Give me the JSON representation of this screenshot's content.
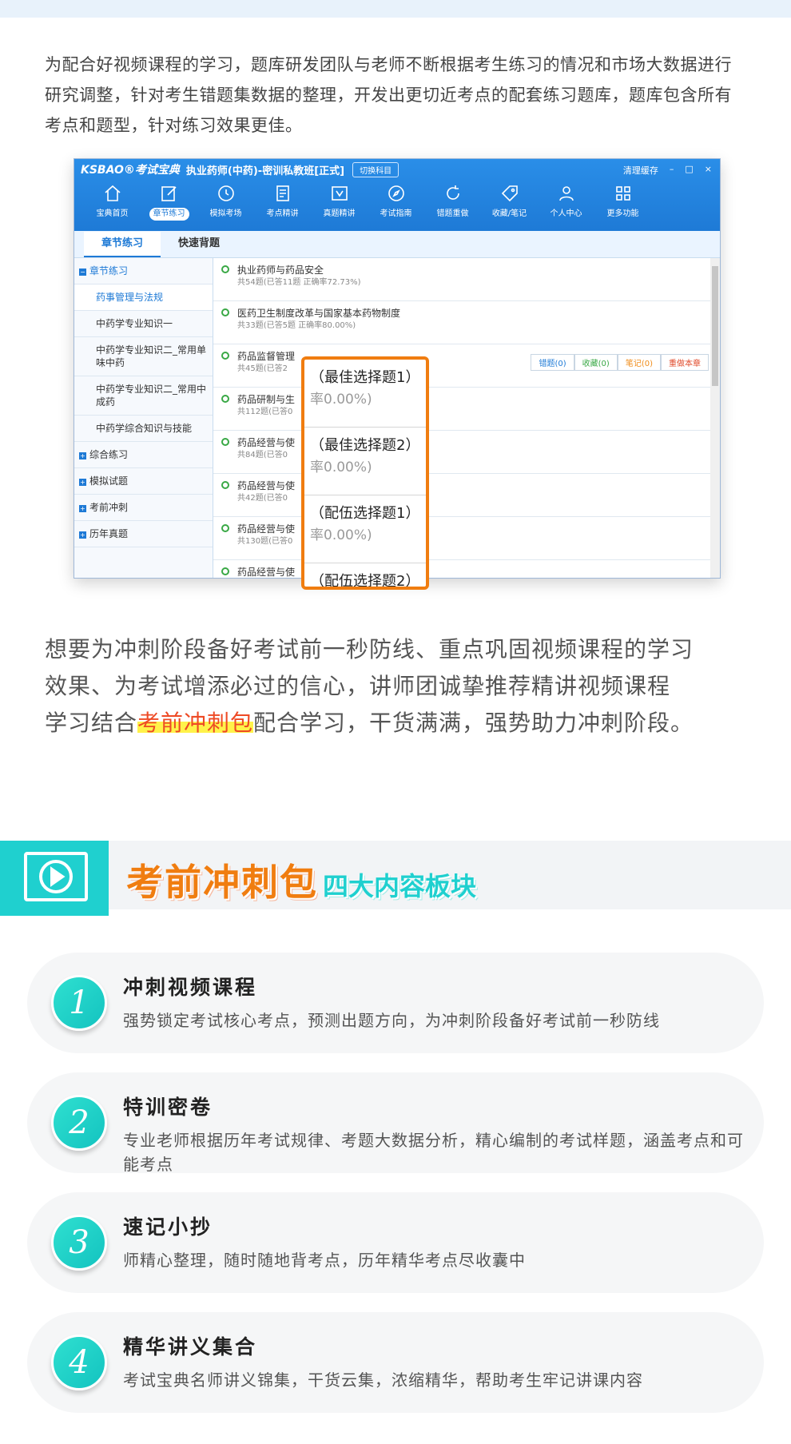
{
  "intro_text": "为配合好视频课程的学习，题库研发团队与老师不断根据考生练习的情况和市场大数据进行研究调整，针对考生错题集数据的整理，开发出更切近考点的配套练习题库，题库包含所有考点和题型，针对练习效果更佳。",
  "app": {
    "logo": "KSBAO®考试宝典",
    "title": "执业药师(中药)-密训私教班[正式]",
    "switch_label": "切换科目",
    "clear_cache": "清理缓存",
    "toolbar": [
      {
        "label": "宝典首页",
        "icon": "home-icon"
      },
      {
        "label": "章节练习",
        "icon": "edit-icon",
        "active": true
      },
      {
        "label": "模拟考场",
        "icon": "clock-icon"
      },
      {
        "label": "考点精讲",
        "icon": "document-icon"
      },
      {
        "label": "真题精讲",
        "icon": "book-icon"
      },
      {
        "label": "考试指南",
        "icon": "compass-icon"
      },
      {
        "label": "错题重做",
        "icon": "refresh-icon"
      },
      {
        "label": "收藏/笔记",
        "icon": "tag-icon"
      },
      {
        "label": "个人中心",
        "icon": "user-icon"
      },
      {
        "label": "更多功能",
        "icon": "grid-icon"
      }
    ],
    "tabs": [
      "章节练习",
      "快速背题"
    ],
    "sidebar": {
      "root": "章节练习",
      "subitems": [
        "药事管理与法规",
        "中药学专业知识一",
        "中药学专业知识二_常用单味中药",
        "中药学专业知识二_常用中成药",
        "中药学综合知识与技能"
      ],
      "groups": [
        "综合练习",
        "模拟试题",
        "考前冲刺",
        "历年真题"
      ]
    },
    "rows": [
      {
        "title": "执业药师与药品安全",
        "sub": "共54题(已答11题   正确率72.73%)"
      },
      {
        "title": "医药卫生制度改革与国家基本药物制度",
        "sub": "共33题(已答5题   正确率80.00%)"
      },
      {
        "title": "药品监督管理",
        "sub": "共45题(已答2"
      },
      {
        "title": "药品研制与生",
        "sub": "共112题(已答0"
      },
      {
        "title": "药品经营与使",
        "sub": "共84题(已答0"
      },
      {
        "title": "药品经营与使",
        "sub": "共42题(已答0"
      },
      {
        "title": "药品经营与使",
        "sub": "共130题(已答0"
      },
      {
        "title": "药品经营与使",
        "sub": ""
      }
    ],
    "row_buttons": [
      "错题(0)",
      "收藏(0)",
      "笔记(0)",
      "重做本章"
    ]
  },
  "popup": [
    {
      "title": "（最佳选择题1）",
      "rate": "率0.00%)"
    },
    {
      "title": "（最佳选择题2）",
      "rate": "率0.00%)"
    },
    {
      "title": "（配伍选择题1）",
      "rate": "率0.00%)"
    },
    {
      "title": "（配伍选择题2）",
      "rate": ""
    }
  ],
  "para2": {
    "line1": "想要为冲刺阶段备好考试前一秒防线、重点巩固视频课程的学习",
    "line2": "效果、为考试增添必过的信心，讲师团诚挚推荐精讲视频课程",
    "line3_pre": "学习结合",
    "line3_hl": "考前冲刺包",
    "line3_post": "配合学习，干货满满，强势助力冲刺阶段。"
  },
  "section": {
    "title": "考前冲刺包",
    "subtitle": "四大内容板块"
  },
  "cards": [
    {
      "num": "1",
      "title": "冲刺视频课程",
      "desc": "强势锁定考试核心考点，预测出题方向，为冲刺阶段备好考试前一秒防线"
    },
    {
      "num": "2",
      "title": "特训密卷",
      "desc": "专业老师根据历年考试规律、考题大数据分析，精心编制的考试样题，涵盖考点和可能考点"
    },
    {
      "num": "3",
      "title": "速记小抄",
      "desc": "师精心整理，随时随地背考点，历年精华考点尽收囊中"
    },
    {
      "num": "4",
      "title": "精华讲义集合",
      "desc": "考试宝典名师讲义锦集，干货云集，浓缩精华，帮助考生牢记讲课内容"
    }
  ],
  "colors": {
    "accent": "#1fd0cf",
    "orange": "#f07d10",
    "app_blue": "#1e7ad6"
  }
}
